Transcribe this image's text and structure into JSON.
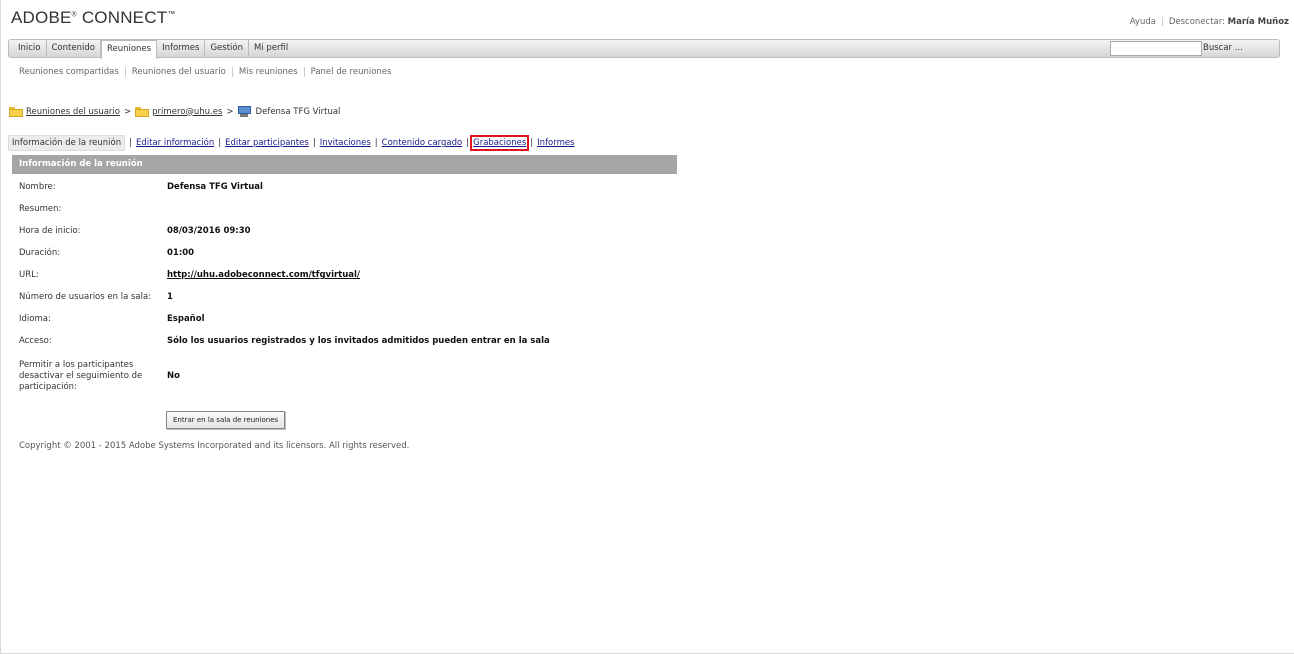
{
  "header": {
    "logo_text": "ADOBE",
    "logo_text2": "CONNECT",
    "help_label": "Ayuda",
    "logout_label": "Desconectar:",
    "user_name": "María Muñoz"
  },
  "nav": {
    "items": [
      {
        "label": "Inicio"
      },
      {
        "label": "Contenido"
      },
      {
        "label": "Reuniones"
      },
      {
        "label": "Informes"
      },
      {
        "label": "Gestión"
      },
      {
        "label": "Mi perfil"
      }
    ],
    "search_placeholder": "",
    "search_label": "Buscar ..."
  },
  "subnav": {
    "items": [
      {
        "label": "Reuniones compartidas"
      },
      {
        "label": "Reuniones del usuario"
      },
      {
        "label": "Mis reuniones"
      },
      {
        "label": "Panel de reuniones"
      }
    ]
  },
  "breadcrumb": {
    "items": [
      {
        "label": "Reuniones del usuario"
      },
      {
        "label": "primero@uhu.es"
      },
      {
        "label": "Defensa TFG Virtual"
      }
    ],
    "sep": ">"
  },
  "tabs": {
    "items": [
      {
        "label": "Información de la reunión"
      },
      {
        "label": "Editar información"
      },
      {
        "label": "Editar participantes"
      },
      {
        "label": "Invitaciones"
      },
      {
        "label": "Contenido cargado"
      },
      {
        "label": "Grabaciones"
      },
      {
        "label": "Informes"
      }
    ],
    "sep": "|"
  },
  "panel": {
    "title": "Información de la reunión",
    "rows": [
      {
        "label": "Nombre:",
        "value": "Defensa TFG Virtual"
      },
      {
        "label": "Resumen:",
        "value": ""
      },
      {
        "label": "Hora de inicio:",
        "value": "08/03/2016 09:30"
      },
      {
        "label": "Duración:",
        "value": "01:00"
      },
      {
        "label": "URL:",
        "value": "http://uhu.adobeconnect.com/tfgvirtual/"
      },
      {
        "label": "Número de usuarios en la sala:",
        "value": "1"
      },
      {
        "label": "Idioma:",
        "value": "Español"
      },
      {
        "label": "Acceso:",
        "value": "Sólo los usuarios registrados y los invitados admitidos pueden entrar en la sala"
      },
      {
        "label": "Permitir a los participantes desactivar el seguimiento de participación:",
        "value": "No"
      }
    ],
    "enter_button": "Entrar en la sala de reuniones"
  },
  "footer": {
    "copyright": "Copyright © 2001 - 2015 Adobe Systems Incorporated and its licensors. All rights reserved."
  }
}
